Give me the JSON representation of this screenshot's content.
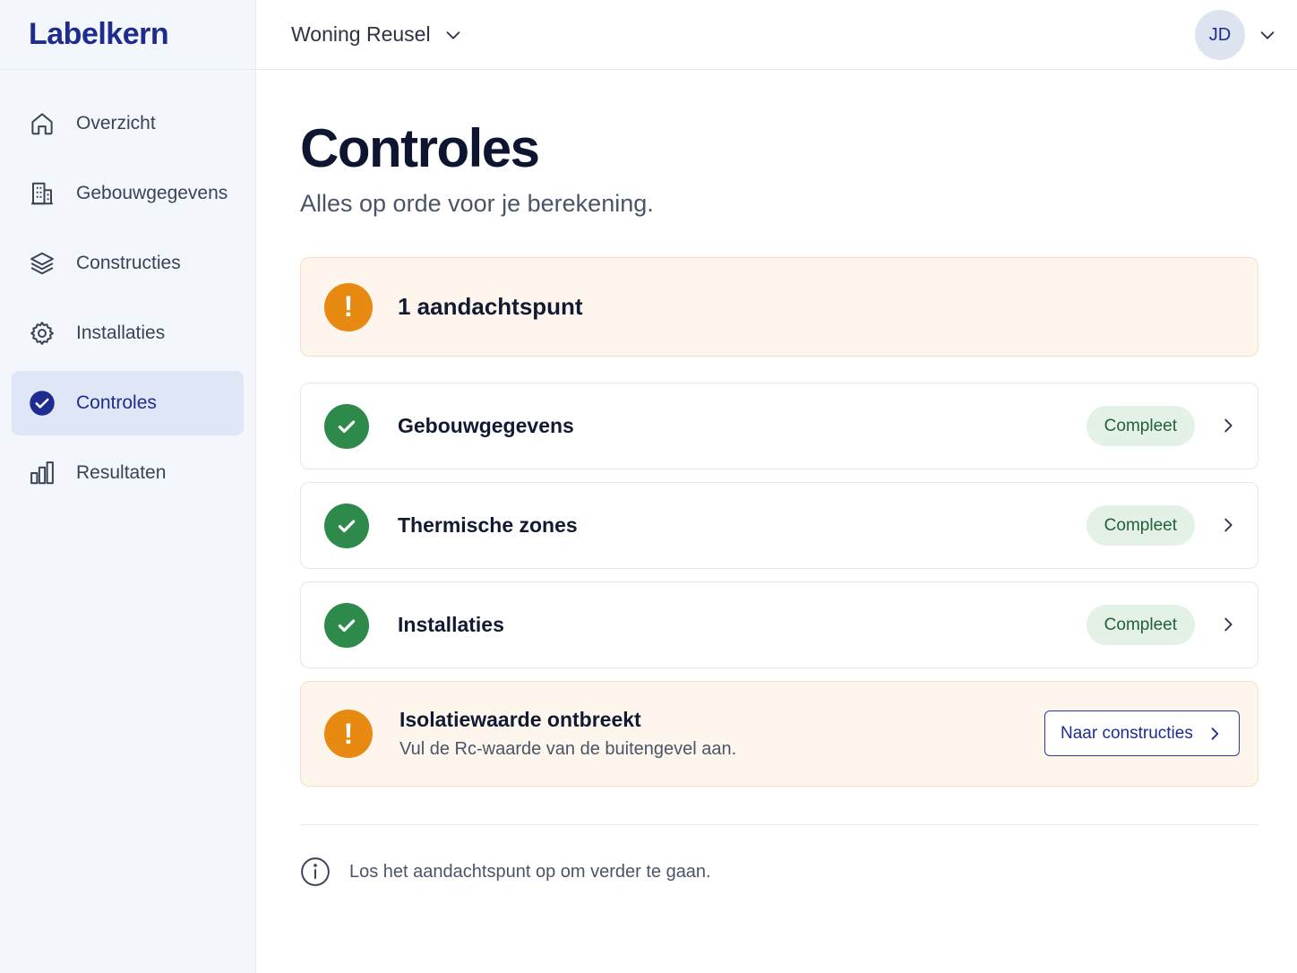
{
  "app": {
    "logo": "Labelkern"
  },
  "sidebar": {
    "items": [
      {
        "label": "Overzicht",
        "icon": "home-icon",
        "active": false
      },
      {
        "label": "Gebouwgegevens",
        "icon": "building-icon",
        "active": false
      },
      {
        "label": "Constructies",
        "icon": "layers-icon",
        "active": false
      },
      {
        "label": "Installaties",
        "icon": "gear-icon",
        "active": false
      },
      {
        "label": "Controles",
        "icon": "check-circle-icon",
        "active": true
      },
      {
        "label": "Resultaten",
        "icon": "bar-chart-icon",
        "active": false
      }
    ]
  },
  "header": {
    "project": "Woning Reusel",
    "user_initials": "JD"
  },
  "main": {
    "title": "Controles",
    "subtitle": "Alles op orde voor je berekening.",
    "summary": {
      "text": "1 aandachtspunt",
      "icon": "warning-icon"
    },
    "checks": [
      {
        "label": "Gebouwgegevens",
        "status": "Compleet"
      },
      {
        "label": "Thermische zones",
        "status": "Compleet"
      },
      {
        "label": "Installaties",
        "status": "Compleet"
      }
    ],
    "issue": {
      "title": "Isolatiewaarde ontbreekt",
      "description": "Vul de Rc-waarde van de buitengevel aan.",
      "button_label": "Naar constructies"
    },
    "footer_note": "Los het aandachtspunt op om verder te gaan."
  },
  "colors": {
    "brand": "#1e2c8f",
    "success": "#2d8a4b",
    "warning": "#e88a12",
    "warning_bg": "#fef6ec"
  }
}
